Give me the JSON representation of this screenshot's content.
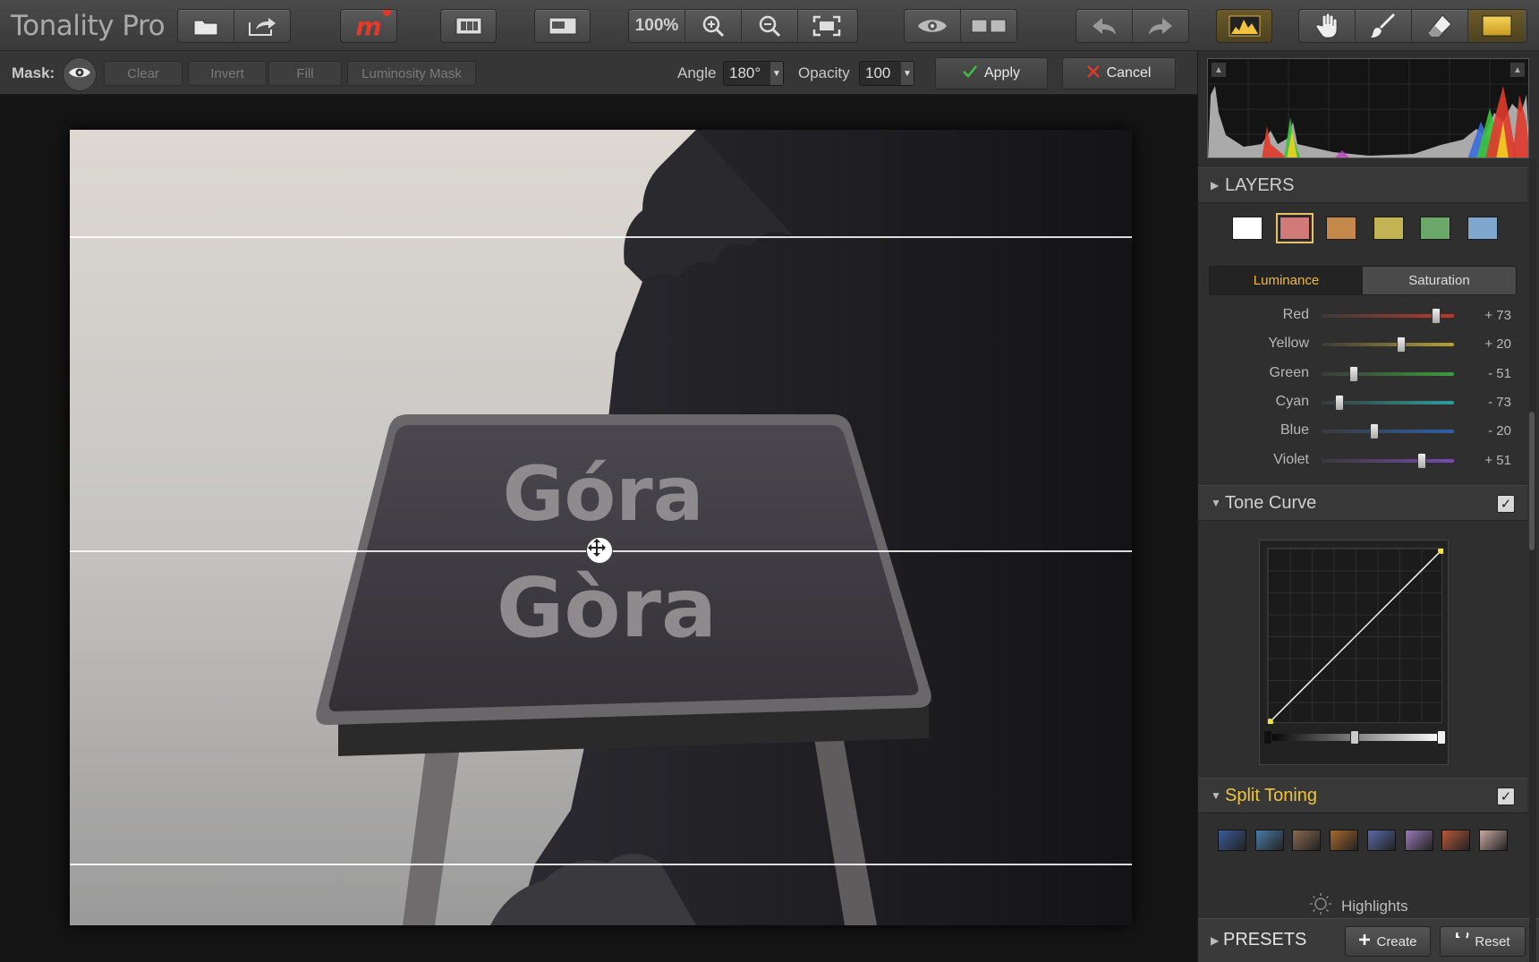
{
  "app": {
    "title": "Tonality Pro"
  },
  "toolbar": {
    "zoom_label": "100%",
    "icons": [
      "open-icon",
      "share-icon",
      "macphun-icon",
      "filmstrip-icon",
      "compare-layout-icon",
      "zoom-in-icon",
      "zoom-out-icon",
      "fit-screen-icon",
      "preview-eye-icon",
      "split-view-icon",
      "undo-icon",
      "redo-icon",
      "histogram-icon",
      "hand-icon",
      "brush-icon",
      "eraser-icon",
      "gradient-icon"
    ]
  },
  "maskbar": {
    "mask_label": "Mask:",
    "clear": "Clear",
    "invert": "Invert",
    "fill": "Fill",
    "luminosity_mask": "Luminosity Mask",
    "angle_label": "Angle",
    "angle_value": "180°",
    "opacity_label": "Opacity",
    "opacity_value": "100",
    "apply": "Apply",
    "cancel": "Cancel"
  },
  "photo": {
    "sign_line1": "Góra",
    "sign_line2": "Gòra"
  },
  "panel": {
    "layers_title": "LAYERS",
    "layer_colors": [
      "#ffffff",
      "#d27a7a",
      "#c4884a",
      "#c2b452",
      "#6aa86a",
      "#7fa6cc"
    ],
    "selected_layer": 1,
    "tab_luminance": "Luminance",
    "tab_saturation": "Saturation",
    "sliders": [
      {
        "label": "Red",
        "value": "+ 73",
        "pos": 0.865,
        "track": "#c0392b"
      },
      {
        "label": "Yellow",
        "value": "+ 20",
        "pos": 0.6,
        "track": "#b7a136"
      },
      {
        "label": "Green",
        "value": "- 51",
        "pos": 0.245,
        "track": "#3e9a3e"
      },
      {
        "label": "Cyan",
        "value": "- 73",
        "pos": 0.135,
        "track": "#2c9e9e"
      },
      {
        "label": "Blue",
        "value": "- 20",
        "pos": 0.4,
        "track": "#2f5fa8"
      },
      {
        "label": "Violet",
        "value": "+ 51",
        "pos": 0.755,
        "track": "#7a48b3"
      }
    ],
    "tone_curve_title": "Tone Curve",
    "split_toning_title": "Split Toning",
    "toning_swatches": [
      "#3b5a9a",
      "#4a7ca8",
      "#8a6a52",
      "#a86a2c",
      "#5a6aa8",
      "#9a7ab8",
      "#b8583a",
      "#c8a8a0"
    ],
    "highlights_label": "Highlights",
    "presets_title": "PRESETS",
    "create": "Create",
    "reset": "Reset"
  },
  "colors": {
    "accent": "#f0b93a",
    "apply_check": "#3fbf3f",
    "cancel_x": "#e03a2a"
  }
}
